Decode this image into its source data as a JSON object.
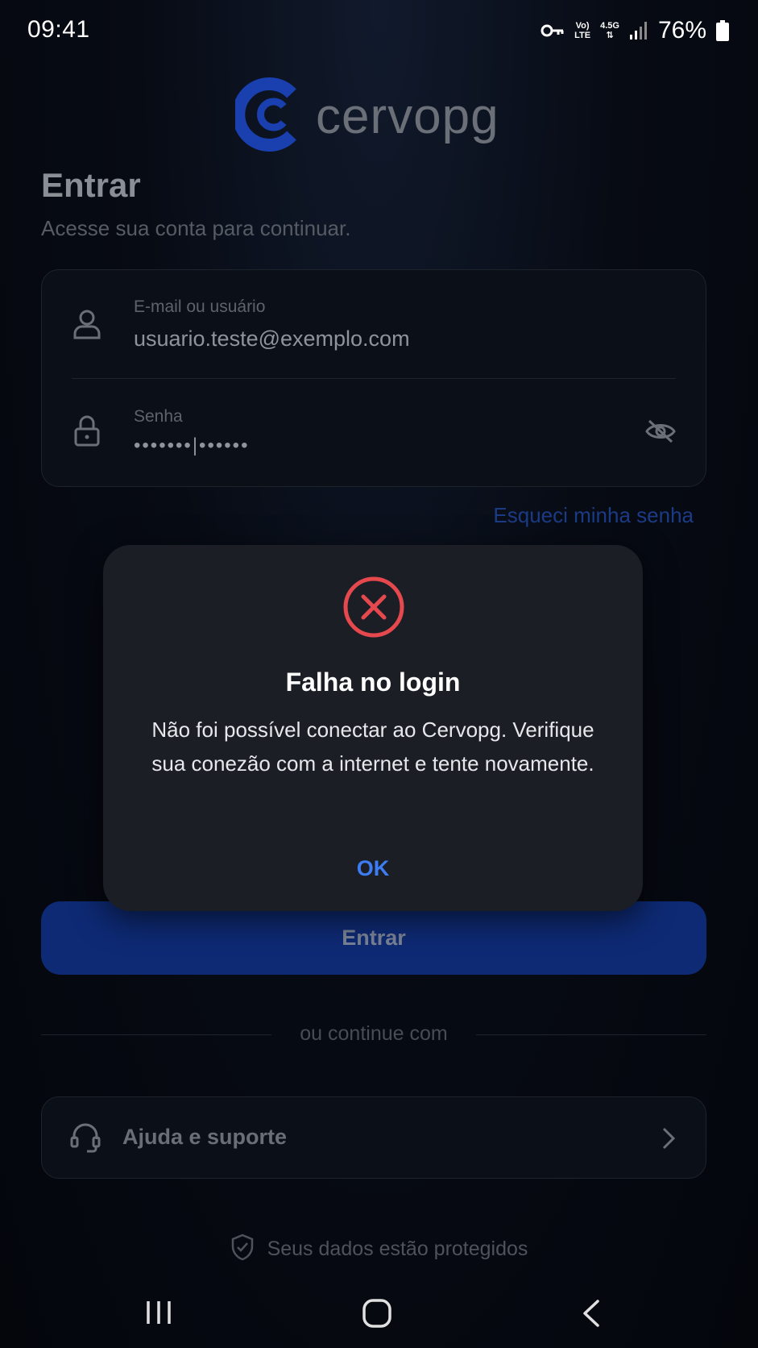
{
  "status_bar": {
    "time": "09:41",
    "network_top": "Vo)",
    "network_bottom": "LTE",
    "network_gen": "4.5G",
    "battery": "76%"
  },
  "brand": {
    "name": "cervopg",
    "primary_color": "#1d46c8"
  },
  "login": {
    "title": "Entrar",
    "subtitle": "Acesse sua conta para continuar.",
    "email_label": "E-mail ou usuário",
    "email_value": "usuario.teste@exemplo.com",
    "password_label": "Senha",
    "password_value": "•••••••|••••••",
    "forgot_password": "Esqueci minha senha",
    "submit_label": "Entrar",
    "divider_text": "ou continue com",
    "support_label": "Ajuda e suporte",
    "secure_note": "Seus dados estão protegidos"
  },
  "dialog": {
    "title": "Falha no login",
    "message": "Não foi possível conectar ao Cervopg. Verifique sua conezão com a internet e tente novamente.",
    "ok_label": "OK",
    "error_color": "#e5484d",
    "action_color": "#3d7cf2"
  }
}
